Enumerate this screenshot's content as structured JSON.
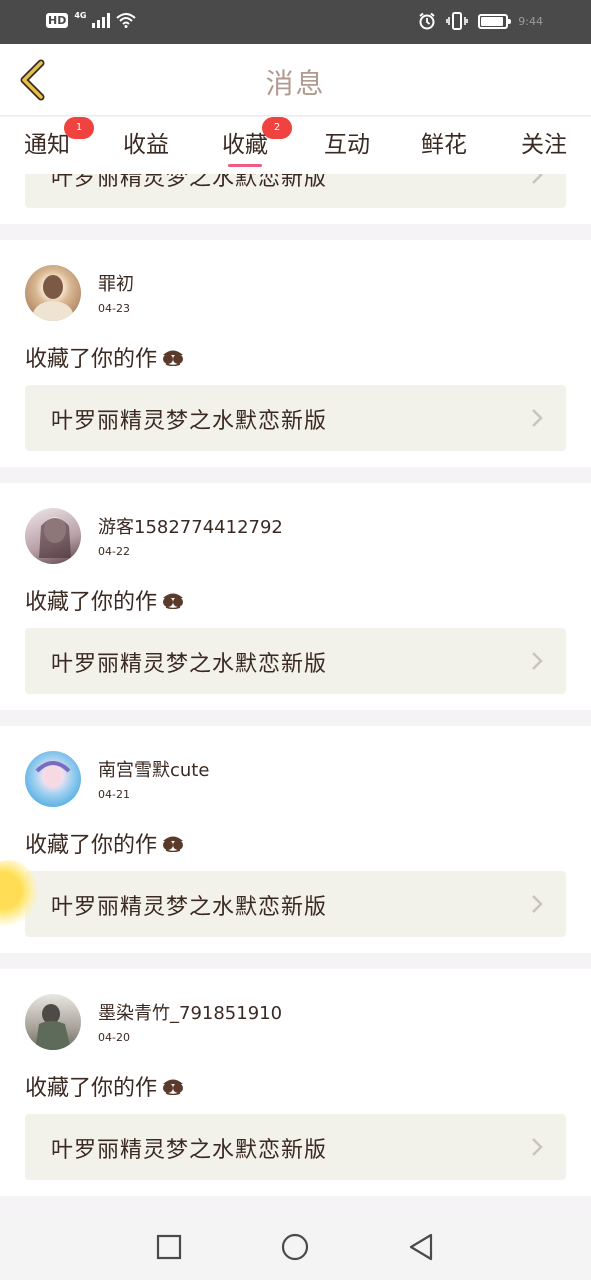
{
  "status_bar": {
    "hd": "HD",
    "network": "4G",
    "time": "9:44"
  },
  "header": {
    "title": "消息"
  },
  "tabs": [
    {
      "label": "通知",
      "badge": "1"
    },
    {
      "label": "收益",
      "badge": ""
    },
    {
      "label": "收藏",
      "badge": "2",
      "active": true
    },
    {
      "label": "互动",
      "badge": ""
    },
    {
      "label": "鲜花",
      "badge": ""
    },
    {
      "label": "关注",
      "badge": ""
    }
  ],
  "top_partial": {
    "work_title": "叶罗丽精灵梦之水默恋新版"
  },
  "items": [
    {
      "username": "罪初",
      "date": "04-23",
      "action": "收藏了你的作",
      "work_title": "叶罗丽精灵梦之水默恋新版"
    },
    {
      "username": "游客1582774412792",
      "date": "04-22",
      "action": "收藏了你的作",
      "work_title": "叶罗丽精灵梦之水默恋新版"
    },
    {
      "username": "南宫雪默cute",
      "date": "04-21",
      "action": "收藏了你的作",
      "work_title": "叶罗丽精灵梦之水默恋新版"
    },
    {
      "username": "墨染青竹_791851910",
      "date": "04-20",
      "action": "收藏了你的作",
      "work_title": "叶罗丽精灵梦之水默恋新版"
    }
  ],
  "colors": {
    "accent": "#ef5d86",
    "badge": "#f0433f",
    "title": "#b39a90",
    "back": "#e5c24a",
    "card_bg": "#f2f2ea"
  }
}
